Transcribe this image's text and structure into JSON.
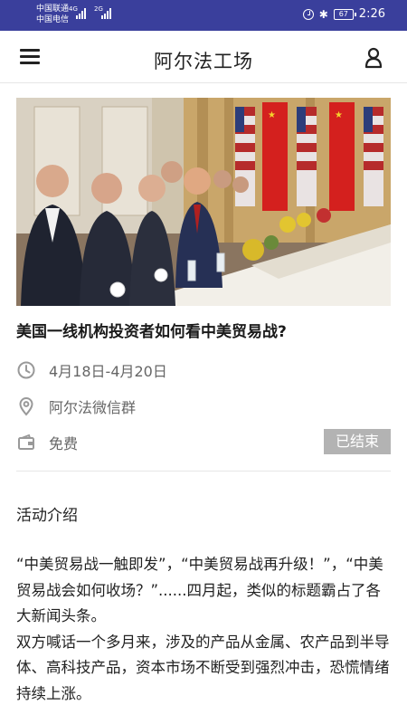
{
  "status_bar": {
    "carrier_1": "中国联通",
    "carrier_2": "中国电信",
    "net_1": "4G",
    "net_2": "2G",
    "battery": "67",
    "time": "2:26"
  },
  "header": {
    "title": "阿尔法工场",
    "menu_icon": "menu-icon",
    "user_icon": "user-icon"
  },
  "event": {
    "title": "美国一线机构投资者如何看中美贸易战?",
    "date": "4月18日-4月20日",
    "location": "阿尔法微信群",
    "fee": "免费",
    "status": "已结束"
  },
  "intro": {
    "label": "活动介绍",
    "paragraph_1": "“中美贸易战一触即发”，“中美贸易战再升级！”，“中美贸易战会如何收场？”......四月起，类似的标题霸占了各大新闻头条。",
    "paragraph_2": "双方喊话一个多月来，涉及的产品从金属、农产品到半导体、高科技产品，资本市场不断受到强烈冲击，恐慌情绪持续上涨。"
  },
  "colors": {
    "status_bar": "#3a3f9c",
    "badge": "#b3b3b3"
  }
}
